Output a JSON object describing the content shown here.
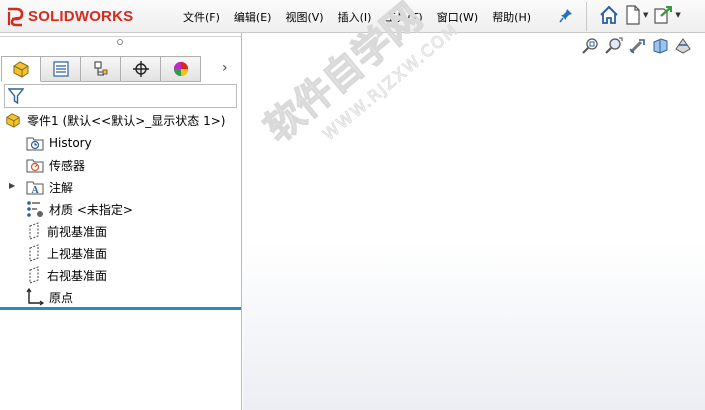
{
  "app": {
    "logo_text": "SOLIDWORKS",
    "logo_prefix_icon": "ds-logo-icon",
    "brand_color": "#d52b1e"
  },
  "menubar": {
    "items": [
      {
        "label": "文件(F)"
      },
      {
        "label": "编辑(E)"
      },
      {
        "label": "视图(V)"
      },
      {
        "label": "插入(I)"
      },
      {
        "label": "工具(T)"
      },
      {
        "label": "窗口(W)"
      },
      {
        "label": "帮助(H)"
      }
    ],
    "pin_icon": "pin-icon",
    "toolbar_icons": [
      "home-icon",
      "new-document-icon",
      "open-document-icon"
    ]
  },
  "feature_manager": {
    "tabs": [
      "feature-tree-tab",
      "property-manager-tab",
      "configuration-manager-tab",
      "dimxpert-tab",
      "display-manager-tab"
    ],
    "filter_icon": "filter-icon",
    "root": {
      "label": "零件1 (默认<<默认>_显示状态 1>)"
    },
    "items": [
      {
        "label": "History",
        "icon": "history-folder-icon"
      },
      {
        "label": "传感器",
        "icon": "sensor-folder-icon"
      },
      {
        "label": "注解",
        "icon": "annotations-folder-icon",
        "expandable": true
      },
      {
        "label": "材质 <未指定>",
        "icon": "material-icon"
      },
      {
        "label": "前视基准面",
        "icon": "plane-icon"
      },
      {
        "label": "上视基准面",
        "icon": "plane-icon"
      },
      {
        "label": "右视基准面",
        "icon": "plane-icon"
      },
      {
        "label": "原点",
        "icon": "origin-icon"
      }
    ],
    "accent_color": "#2f87c9"
  },
  "graphics_area": {
    "heads_up_icons": [
      "zoom-to-fit-icon",
      "zoom-to-area-icon",
      "previous-view-icon",
      "section-view-icon",
      "view-orientation-icon"
    ]
  },
  "watermark": {
    "text": "软件自学网",
    "subtext": "WWW.RJZXW.COM"
  }
}
